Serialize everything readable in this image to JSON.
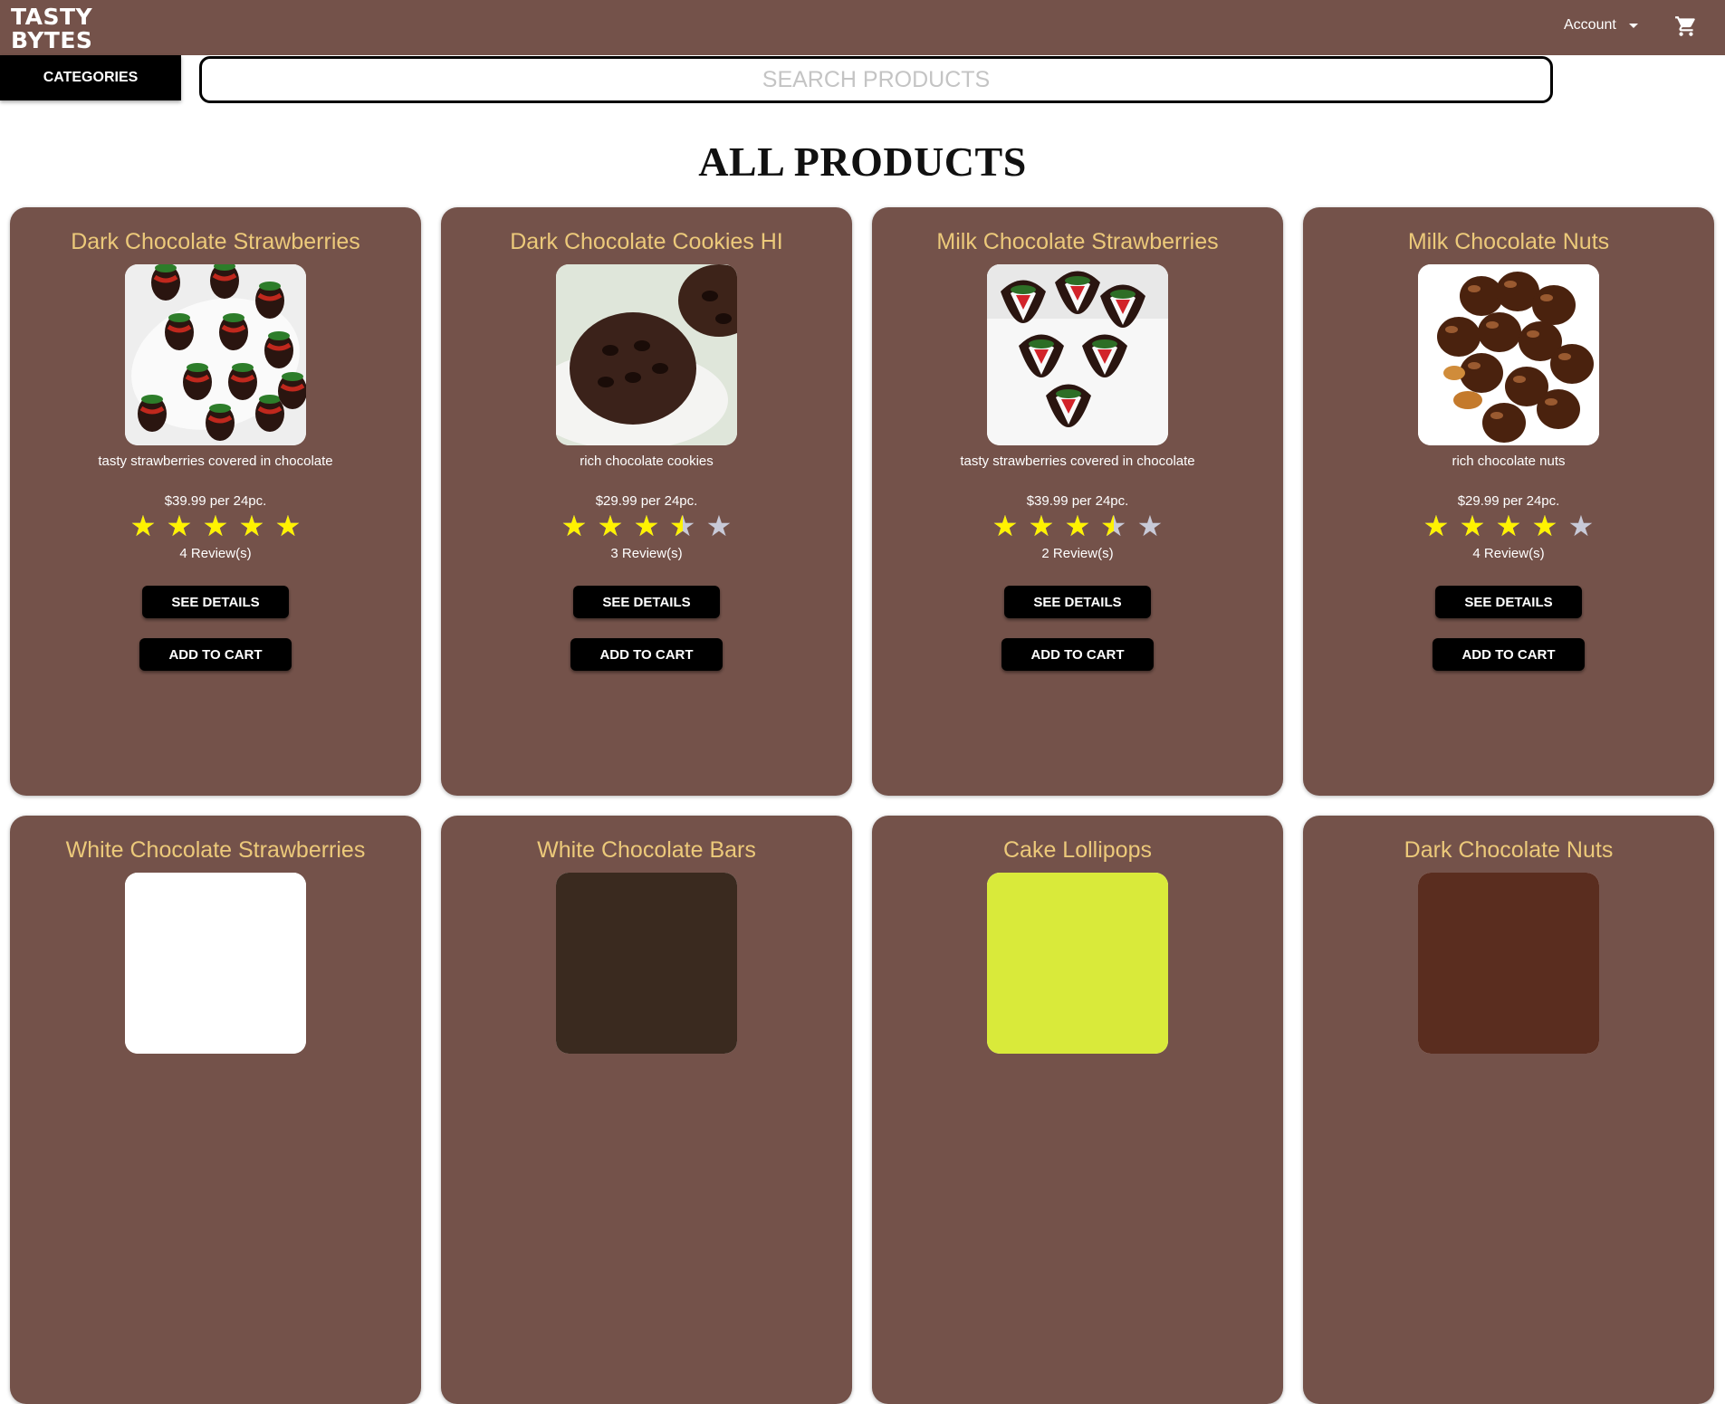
{
  "header": {
    "logo_text": "TASTY BYTES",
    "account_label": "Account",
    "cart_icon": "shopping-cart-icon"
  },
  "nav": {
    "categories_label": "CATEGORIES",
    "search_placeholder": "SEARCH PRODUCTS"
  },
  "page": {
    "title": "ALL PRODUCTS"
  },
  "colors": {
    "brand_brown": "#74524a",
    "product_name": "#ecc97a",
    "star_filled": "#fff200",
    "star_empty": "#c8cad8"
  },
  "button_labels": {
    "see_details": "SEE DETAILS",
    "add_to_cart": "ADD TO CART"
  },
  "products": [
    {
      "name": "Dark Chocolate Strawberries",
      "description": "tasty strawberries covered in chocolate",
      "price": "$39.99 per 24pc.",
      "rating": 5,
      "reviews": "4 Review(s)",
      "image": "dark-chocolate-strawberries"
    },
    {
      "name": "Dark Chocolate Cookies HI",
      "description": "rich chocolate cookies",
      "price": "$29.99 per 24pc.",
      "rating": 3.5,
      "reviews": "3 Review(s)",
      "image": "chocolate-cookie"
    },
    {
      "name": "Milk Chocolate Strawberries",
      "description": "tasty strawberries covered in chocolate",
      "price": "$39.99 per 24pc.",
      "rating": 3.5,
      "reviews": "2 Review(s)",
      "image": "milk-chocolate-strawberries"
    },
    {
      "name": "Milk Chocolate Nuts",
      "description": "rich chocolate nuts",
      "price": "$29.99 per 24pc.",
      "rating": 4,
      "reviews": "4 Review(s)",
      "image": "chocolate-nuts"
    },
    {
      "name": "White Chocolate Strawberries",
      "image": "white-chocolate-strawberries"
    },
    {
      "name": "White Chocolate Bars",
      "image": "white-chocolate-bars"
    },
    {
      "name": "Cake Lollipops",
      "image": "cake-lollipops"
    },
    {
      "name": "Dark Chocolate Nuts",
      "image": "dark-chocolate-nuts"
    }
  ]
}
